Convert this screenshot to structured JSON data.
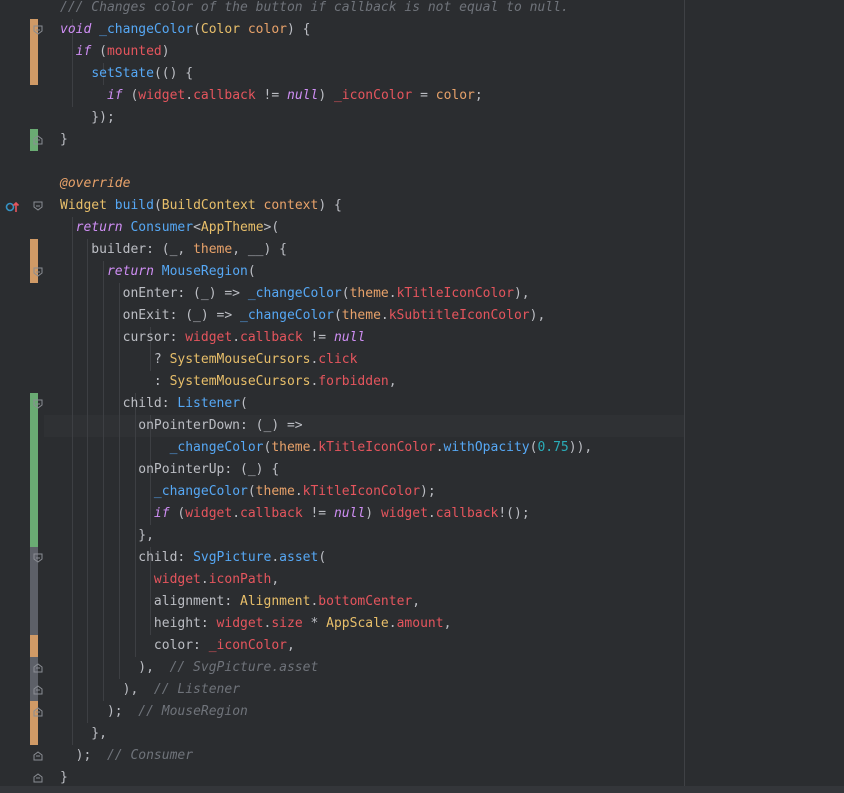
{
  "editor": {
    "language": "Dart",
    "comments": {
      "doc": "/// Changes color of the button if callback is not equal to null.",
      "svg_picture": "// SvgPicture.asset",
      "listener": "// Listener",
      "mouse_region": "// MouseRegion",
      "consumer": "// Consumer"
    },
    "colors": {
      "background": "#2b2d30",
      "vcs_modified": "#d09a66",
      "vcs_added": "#6aab73",
      "vcs_gray": "#6f737a",
      "keyword": "#cf8ef4",
      "function": "#56a8f5",
      "field": "#e5555d",
      "type": "#e8bf6a",
      "comment": "#6f737a"
    },
    "icons": {
      "bulb": "lightbulb-icon",
      "override": "override-gutter-icon",
      "fold": "fold-icon"
    }
  },
  "code": {
    "l1": "/// Changes color of the button if callback is not equal to null.",
    "l2": [
      [
        "kw",
        "void"
      ],
      [
        "p",
        " "
      ],
      [
        "fn",
        "_changeColor"
      ],
      [
        "p",
        "("
      ],
      [
        "type",
        "Color"
      ],
      [
        "p",
        " "
      ],
      [
        "param",
        "color"
      ],
      [
        "p",
        ") {"
      ]
    ],
    "l3": [
      [
        "p",
        "  "
      ],
      [
        "kw",
        "if"
      ],
      [
        "p",
        " ("
      ],
      [
        "field",
        "mounted"
      ],
      [
        "p",
        ")"
      ]
    ],
    "l4": [
      [
        "p",
        "    "
      ],
      [
        "fn",
        "setState"
      ],
      [
        "p",
        "(() {"
      ]
    ],
    "l5": [
      [
        "p",
        "      "
      ],
      [
        "kw",
        "if"
      ],
      [
        "p",
        " ("
      ],
      [
        "field",
        "widget"
      ],
      [
        "p",
        "."
      ],
      [
        "field",
        "callback"
      ],
      [
        "p",
        " != "
      ],
      [
        "kw",
        "null"
      ],
      [
        "p",
        ") "
      ],
      [
        "field",
        "_iconColor"
      ],
      [
        "p",
        " = "
      ],
      [
        "param",
        "color"
      ],
      [
        "p",
        ";"
      ]
    ],
    "l6": [
      [
        "p",
        "    });"
      ]
    ],
    "l7": [
      [
        "p",
        "}"
      ]
    ],
    "l8": [
      [
        "p",
        ""
      ]
    ],
    "l9": [
      [
        "ann",
        "@override"
      ]
    ],
    "l10": [
      [
        "type",
        "Widget"
      ],
      [
        "p",
        " "
      ],
      [
        "fn",
        "build"
      ],
      [
        "p",
        "("
      ],
      [
        "type",
        "BuildContext"
      ],
      [
        "p",
        " "
      ],
      [
        "param",
        "context"
      ],
      [
        "p",
        ") {"
      ]
    ],
    "l11": [
      [
        "p",
        "  "
      ],
      [
        "kw",
        "return"
      ],
      [
        "p",
        " "
      ],
      [
        "fn",
        "Consumer"
      ],
      [
        "p",
        "<"
      ],
      [
        "type",
        "AppTheme"
      ],
      [
        "p",
        ">("
      ]
    ],
    "l12": [
      [
        "p",
        "    builder: (_, "
      ],
      [
        "param",
        "theme"
      ],
      [
        "p",
        ", __) {"
      ]
    ],
    "l13": [
      [
        "p",
        "      "
      ],
      [
        "kw",
        "return"
      ],
      [
        "p",
        " "
      ],
      [
        "fn",
        "MouseRegion"
      ],
      [
        "p",
        "("
      ]
    ],
    "l14": [
      [
        "p",
        "        onEnter: (_) => "
      ],
      [
        "fn",
        "_changeColor"
      ],
      [
        "p",
        "("
      ],
      [
        "param",
        "theme"
      ],
      [
        "p",
        "."
      ],
      [
        "field",
        "kTitleIconColor"
      ],
      [
        "p",
        "),"
      ]
    ],
    "l15": [
      [
        "p",
        "        onExit: (_) => "
      ],
      [
        "fn",
        "_changeColor"
      ],
      [
        "p",
        "("
      ],
      [
        "param",
        "theme"
      ],
      [
        "p",
        "."
      ],
      [
        "field",
        "kSubtitleIconColor"
      ],
      [
        "p",
        "),"
      ]
    ],
    "l16": [
      [
        "p",
        "        cursor: "
      ],
      [
        "field",
        "widget"
      ],
      [
        "p",
        "."
      ],
      [
        "field",
        "callback"
      ],
      [
        "p",
        " != "
      ],
      [
        "kw",
        "null"
      ]
    ],
    "l17": [
      [
        "p",
        "            ? "
      ],
      [
        "type",
        "SystemMouseCursors"
      ],
      [
        "p",
        "."
      ],
      [
        "field",
        "click"
      ]
    ],
    "l18": [
      [
        "p",
        "            : "
      ],
      [
        "type",
        "SystemMouseCursors"
      ],
      [
        "p",
        "."
      ],
      [
        "field",
        "forbidden"
      ],
      [
        "p",
        ","
      ]
    ],
    "l19": [
      [
        "p",
        "        child: "
      ],
      [
        "fn",
        "Listener"
      ],
      [
        "p",
        "("
      ]
    ],
    "l20": [
      [
        "p",
        "          onPointerDown: (_) =>"
      ]
    ],
    "l21": [
      [
        "p",
        "              "
      ],
      [
        "fn",
        "_changeColor"
      ],
      [
        "p",
        "("
      ],
      [
        "param",
        "theme"
      ],
      [
        "p",
        "."
      ],
      [
        "field",
        "kTitleIconColor"
      ],
      [
        "p",
        "."
      ],
      [
        "fn",
        "withOpacity"
      ],
      [
        "p",
        "("
      ],
      [
        "num",
        "0.75"
      ],
      [
        "p",
        ")),"
      ]
    ],
    "l22": [
      [
        "p",
        "          onPointerUp: (_) {"
      ]
    ],
    "l23": [
      [
        "p",
        "            "
      ],
      [
        "fn",
        "_changeColor"
      ],
      [
        "p",
        "("
      ],
      [
        "param",
        "theme"
      ],
      [
        "p",
        "."
      ],
      [
        "field",
        "kTitleIconColor"
      ],
      [
        "p",
        ");"
      ]
    ],
    "l24": [
      [
        "p",
        "            "
      ],
      [
        "kw",
        "if"
      ],
      [
        "p",
        " ("
      ],
      [
        "field",
        "widget"
      ],
      [
        "p",
        "."
      ],
      [
        "field",
        "callback"
      ],
      [
        "p",
        " != "
      ],
      [
        "kw",
        "null"
      ],
      [
        "p",
        ") "
      ],
      [
        "field",
        "widget"
      ],
      [
        "p",
        "."
      ],
      [
        "field",
        "callback"
      ],
      [
        "p",
        "!();"
      ]
    ],
    "l25": [
      [
        "p",
        "          },"
      ]
    ],
    "l26": [
      [
        "p",
        "          child: "
      ],
      [
        "fn",
        "SvgPicture"
      ],
      [
        "p",
        "."
      ],
      [
        "fn",
        "asset"
      ],
      [
        "p",
        "("
      ]
    ],
    "l27": [
      [
        "p",
        "            "
      ],
      [
        "field",
        "widget"
      ],
      [
        "p",
        "."
      ],
      [
        "field",
        "iconPath"
      ],
      [
        "p",
        ","
      ]
    ],
    "l28": [
      [
        "p",
        "            alignment: "
      ],
      [
        "type",
        "Alignment"
      ],
      [
        "p",
        "."
      ],
      [
        "field",
        "bottomCenter"
      ],
      [
        "p",
        ","
      ]
    ],
    "l29": [
      [
        "p",
        "            height: "
      ],
      [
        "field",
        "widget"
      ],
      [
        "p",
        "."
      ],
      [
        "field",
        "size"
      ],
      [
        "p",
        " * "
      ],
      [
        "type",
        "AppScale"
      ],
      [
        "p",
        "."
      ],
      [
        "field",
        "amount"
      ],
      [
        "p",
        ","
      ]
    ],
    "l30": [
      [
        "p",
        "            color: "
      ],
      [
        "field",
        "_iconColor"
      ],
      [
        "p",
        ","
      ]
    ],
    "l31": [
      [
        "p",
        "          ),  "
      ],
      [
        "cm",
        "// SvgPicture.asset"
      ]
    ],
    "l32": [
      [
        "p",
        "        ),  "
      ],
      [
        "cm",
        "// Listener"
      ]
    ],
    "l33": [
      [
        "p",
        "      );  "
      ],
      [
        "cm",
        "// MouseRegion"
      ]
    ],
    "l34": [
      [
        "p",
        "    },"
      ]
    ],
    "l35": [
      [
        "p",
        "  );  "
      ],
      [
        "cm",
        "// Consumer"
      ]
    ],
    "l36": [
      [
        "p",
        "}"
      ]
    ]
  }
}
